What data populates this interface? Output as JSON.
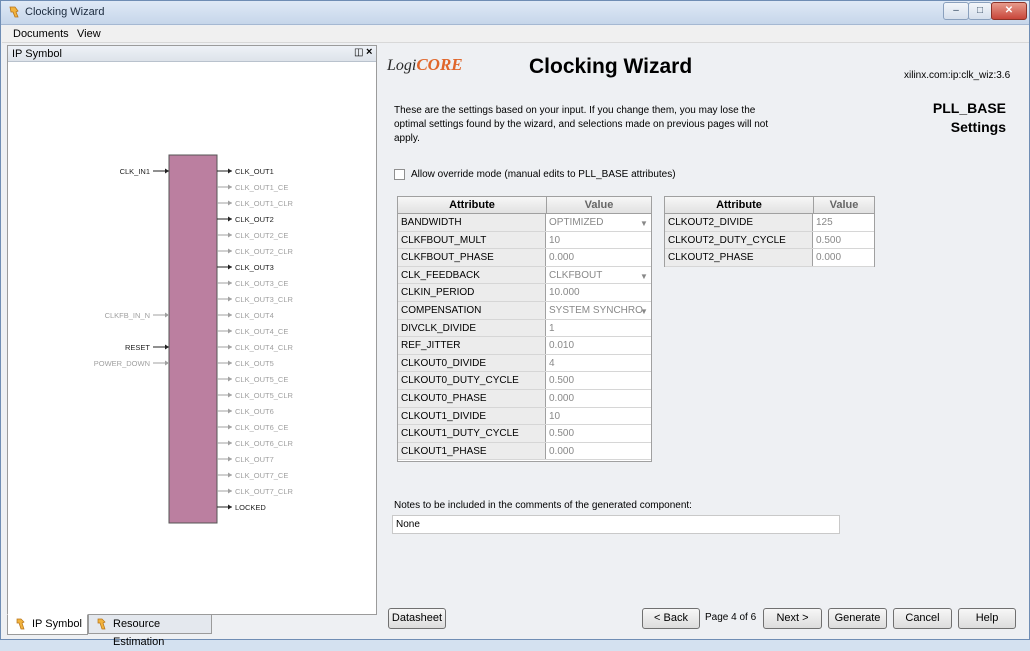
{
  "window": {
    "title": "Clocking Wizard",
    "min": "–",
    "max": "□",
    "close": "✕"
  },
  "menu": {
    "items": [
      "Documents",
      "View"
    ]
  },
  "left_panel": {
    "title": "IP Symbol",
    "symbol": {
      "inputs": [
        {
          "label": "CLK_IN1",
          "active": true
        },
        {
          "label": "CLKFB_IN_N",
          "active": false
        },
        {
          "label": "RESET",
          "active": true
        },
        {
          "label": "POWER_DOWN",
          "active": false
        }
      ],
      "outputs": [
        {
          "label": "CLK_OUT1",
          "active": true
        },
        {
          "label": "CLK_OUT1_CE",
          "active": false
        },
        {
          "label": "CLK_OUT1_CLR",
          "active": false
        },
        {
          "label": "CLK_OUT2",
          "active": true
        },
        {
          "label": "CLK_OUT2_CE",
          "active": false
        },
        {
          "label": "CLK_OUT2_CLR",
          "active": false
        },
        {
          "label": "CLK_OUT3",
          "active": true
        },
        {
          "label": "CLK_OUT3_CE",
          "active": false
        },
        {
          "label": "CLK_OUT3_CLR",
          "active": false
        },
        {
          "label": "CLK_OUT4",
          "active": false
        },
        {
          "label": "CLK_OUT4_CE",
          "active": false
        },
        {
          "label": "CLK_OUT4_CLR",
          "active": false
        },
        {
          "label": "CLK_OUT5",
          "active": false
        },
        {
          "label": "CLK_OUT5_CE",
          "active": false
        },
        {
          "label": "CLK_OUT5_CLR",
          "active": false
        },
        {
          "label": "CLK_OUT6",
          "active": false
        },
        {
          "label": "CLK_OUT6_CE",
          "active": false
        },
        {
          "label": "CLK_OUT6_CLR",
          "active": false
        },
        {
          "label": "CLK_OUT7",
          "active": false
        },
        {
          "label": "CLK_OUT7_CE",
          "active": false
        },
        {
          "label": "CLK_OUT7_CLR",
          "active": false
        },
        {
          "label": "LOCKED",
          "active": true
        }
      ]
    }
  },
  "bottom_tabs": [
    "IP Symbol",
    "Resource Estimation"
  ],
  "header": {
    "logo_a": "Logi",
    "logo_b": "CORE",
    "title": "Clocking Wizard",
    "ip_id": "xilinx.com:ip:clk_wiz:3.6",
    "section_line1": "PLL_BASE",
    "section_line2": "Settings"
  },
  "intro": "These are the settings based on your input.  If you change them, you may lose the optimal settings found by the wizard, and selections made on previous pages will not apply.",
  "override_label": "Allow override mode (manual edits to PLL_BASE attributes)",
  "table_headers": {
    "attribute": "Attribute",
    "value": "Value"
  },
  "table1": [
    {
      "attr": "BANDWIDTH",
      "val": "OPTIMIZED",
      "dropdown": true
    },
    {
      "attr": "CLKFBOUT_MULT",
      "val": "10",
      "dropdown": false
    },
    {
      "attr": "CLKFBOUT_PHASE",
      "val": "0.000",
      "dropdown": false
    },
    {
      "attr": "CLK_FEEDBACK",
      "val": "CLKFBOUT",
      "dropdown": true
    },
    {
      "attr": "CLKIN_PERIOD",
      "val": "10.000",
      "dropdown": false
    },
    {
      "attr": "COMPENSATION",
      "val": "SYSTEM SYNCHRO",
      "dropdown": true
    },
    {
      "attr": "DIVCLK_DIVIDE",
      "val": "1",
      "dropdown": false
    },
    {
      "attr": "REF_JITTER",
      "val": "0.010",
      "dropdown": false
    },
    {
      "attr": "CLKOUT0_DIVIDE",
      "val": "4",
      "dropdown": false
    },
    {
      "attr": "CLKOUT0_DUTY_CYCLE",
      "val": "0.500",
      "dropdown": false
    },
    {
      "attr": "CLKOUT0_PHASE",
      "val": "0.000",
      "dropdown": false
    },
    {
      "attr": "CLKOUT1_DIVIDE",
      "val": "10",
      "dropdown": false
    },
    {
      "attr": "CLKOUT1_DUTY_CYCLE",
      "val": "0.500",
      "dropdown": false
    },
    {
      "attr": "CLKOUT1_PHASE",
      "val": "0.000",
      "dropdown": false
    }
  ],
  "table2": [
    {
      "attr": "CLKOUT2_DIVIDE",
      "val": "125",
      "dropdown": false
    },
    {
      "attr": "CLKOUT2_DUTY_CYCLE",
      "val": "0.500",
      "dropdown": false
    },
    {
      "attr": "CLKOUT2_PHASE",
      "val": "0.000",
      "dropdown": false
    }
  ],
  "notes": {
    "label": "Notes to be included in the comments of the generated component:",
    "value": "None"
  },
  "buttons": {
    "datasheet": "Datasheet",
    "back": "< Back",
    "page": "Page 4 of 6",
    "next": "Next >",
    "generate": "Generate",
    "cancel": "Cancel",
    "help": "Help"
  },
  "colors": {
    "symbol_fill": "#bb7fa0",
    "inactive_pin": "#a0a0a0",
    "logo_accent": "#e0662b"
  }
}
